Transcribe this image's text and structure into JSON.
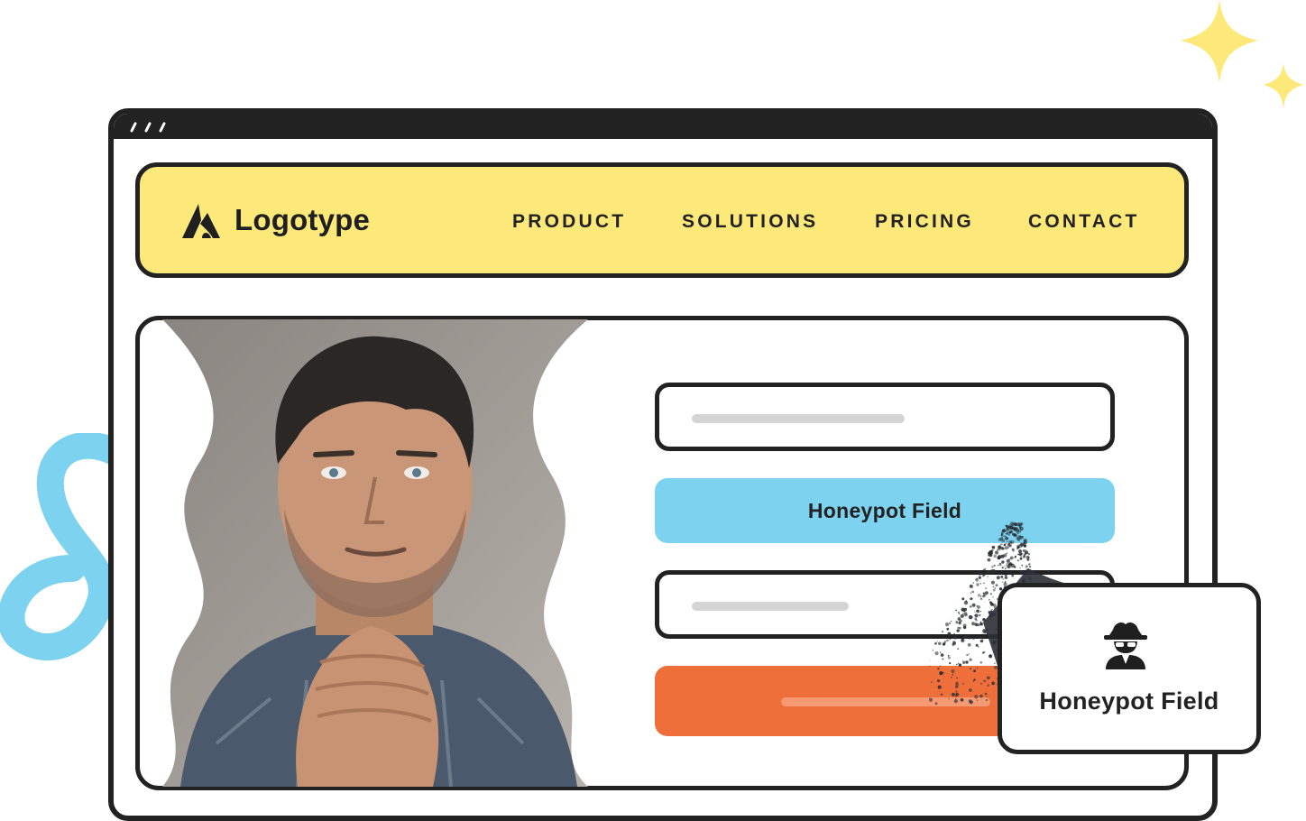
{
  "nav": {
    "logo_text": "Logotype",
    "items": [
      "PRODUCT",
      "SOLUTIONS",
      "PRICING",
      "CONTACT"
    ]
  },
  "form": {
    "honeypot_label": "Honeypot Field"
  },
  "callout": {
    "label": "Honeypot Field",
    "icon": "spy-icon"
  },
  "colors": {
    "nav_bg": "#fde97a",
    "honeypot_bg": "#7dd3ef",
    "submit_bg": "#ef6f3a",
    "outline": "#222222",
    "sparkle": "#fde97a",
    "squiggle": "#7dd3ef"
  }
}
